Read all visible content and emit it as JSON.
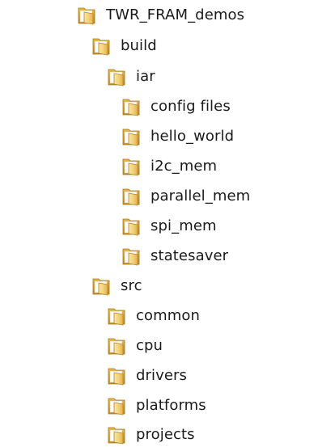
{
  "tree": {
    "root": {
      "label": "TWR_FRAM_demos",
      "icon": "folder-icon"
    },
    "build": {
      "label": "build",
      "icon": "folder-icon"
    },
    "iar": {
      "label": "iar",
      "icon": "folder-icon"
    },
    "config_files": {
      "label": "config files",
      "icon": "folder-icon"
    },
    "hello_world": {
      "label": "hello_world",
      "icon": "folder-icon"
    },
    "i2c_mem": {
      "label": "i2c_mem",
      "icon": "folder-icon"
    },
    "parallel_mem": {
      "label": "parallel_mem",
      "icon": "folder-icon"
    },
    "spi_mem": {
      "label": "spi_mem",
      "icon": "folder-icon"
    },
    "statesaver": {
      "label": "statesaver",
      "icon": "folder-icon"
    },
    "src": {
      "label": "src",
      "icon": "folder-icon"
    },
    "common": {
      "label": "common",
      "icon": "folder-icon"
    },
    "cpu": {
      "label": "cpu",
      "icon": "folder-icon"
    },
    "drivers": {
      "label": "drivers",
      "icon": "folder-icon"
    },
    "platforms": {
      "label": "platforms",
      "icon": "folder-icon"
    },
    "projects": {
      "label": "projects",
      "icon": "folder-icon"
    }
  },
  "colors": {
    "folder_light": "#f6dc8a",
    "folder_dark": "#c8962e",
    "folder_edge": "#a8761a",
    "text": "#1a1a1a",
    "background": "#ffffff"
  }
}
